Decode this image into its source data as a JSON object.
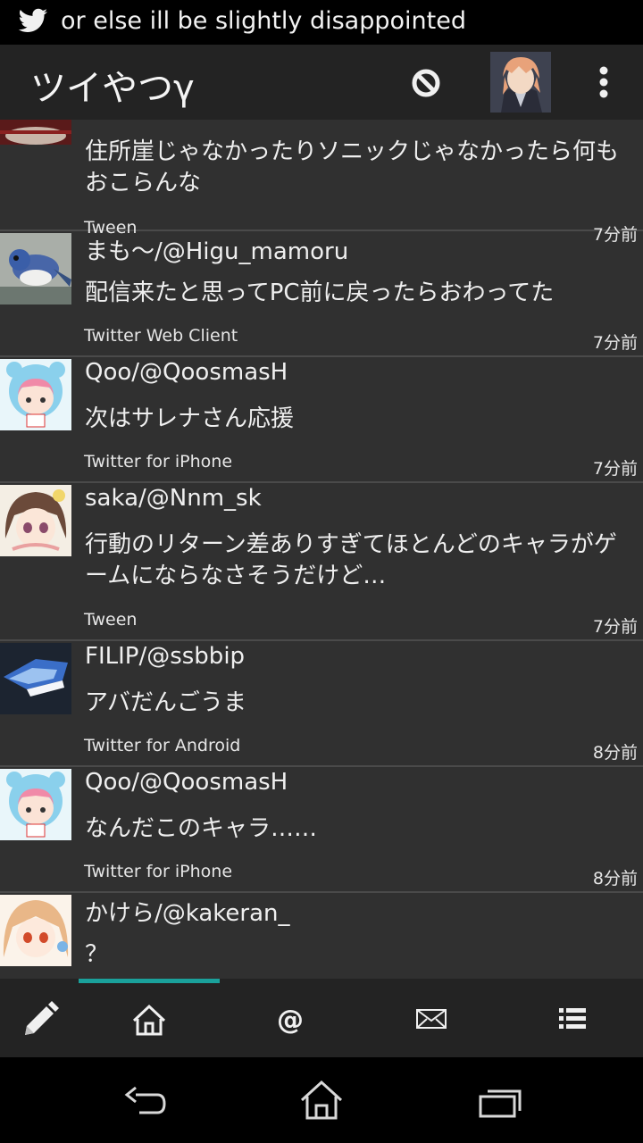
{
  "status_bar": {
    "notification_text": "or else ill be slightly disappointed",
    "notification_icon": "twitter-bird-icon"
  },
  "action_bar": {
    "title": "ツイやつγ",
    "icons": [
      "block-icon",
      "account-avatar",
      "overflow-menu-icon"
    ]
  },
  "tweets": [
    {
      "user": "",
      "text": "住所崖じゃなかったりソニックじゃなかったら何もおこらんな",
      "source": "Tween",
      "time": "7分前"
    },
    {
      "user": "まも〜/@Higu_mamoru",
      "text": "配信来たと思ってPC前に戻ったらおわってた",
      "source": "Twitter Web Client",
      "time": "7分前"
    },
    {
      "user": "Qoo/@QoosmasH",
      "text": "次はサレナさん応援",
      "source": "Twitter for iPhone",
      "time": "7分前"
    },
    {
      "user": "saka/@Nnm_sk",
      "text": "行動のリターン差ありすぎてほとんどのキャラがゲームにならなさそうだけど…",
      "source": "Tween",
      "time": "7分前"
    },
    {
      "user": "FILIP/@ssbbip",
      "text": "アバだんごうま",
      "source": "Twitter for Android",
      "time": "8分前"
    },
    {
      "user": "Qoo/@QoosmasH",
      "text": "なんだこのキャラ……",
      "source": "Twitter for iPhone",
      "time": "8分前"
    },
    {
      "user": "かけら/@kakeran_",
      "text": "？",
      "source": "",
      "time": ""
    }
  ],
  "tabs": [
    {
      "name": "compose",
      "icon": "pencil-icon",
      "selected": false
    },
    {
      "name": "home",
      "icon": "home-icon",
      "selected": true
    },
    {
      "name": "mentions",
      "icon": "at-icon",
      "selected": false
    },
    {
      "name": "messages",
      "icon": "envelope-icon",
      "selected": false
    },
    {
      "name": "lists",
      "icon": "list-icon",
      "selected": false
    }
  ],
  "colors": {
    "accent": "#1aa19b",
    "background": "#303030",
    "bar": "#232323",
    "divider": "#4a4a4a",
    "text": "#efefef"
  },
  "nav_bar": {
    "icons": [
      "back-icon",
      "home-nav-icon",
      "recent-apps-icon"
    ]
  }
}
